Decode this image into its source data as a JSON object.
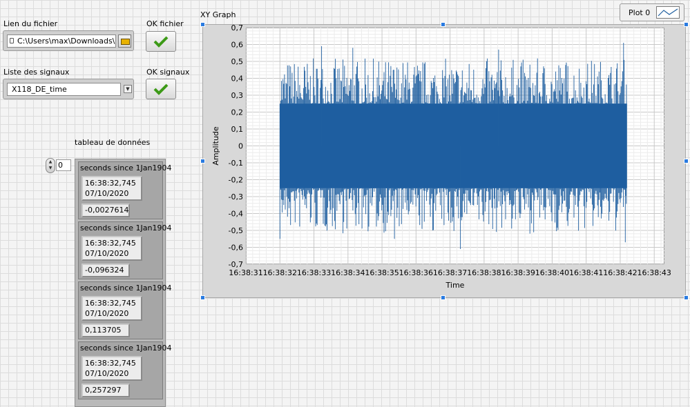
{
  "file_section": {
    "label": "Lien du fichier",
    "path_value": "C:\\Users\\max\\Downloads\\",
    "ok_label": "OK fichier"
  },
  "signal_section": {
    "label": "Liste des signaux",
    "selected": "X118_DE_time",
    "ok_label": "OK signaux"
  },
  "data_table": {
    "label": "tableau de données",
    "index": "0",
    "clusters": [
      {
        "title": "seconds since 1Jan1904",
        "time": "16:38:32,745",
        "date": "07/10/2020",
        "value": "-0,0027614"
      },
      {
        "title": "seconds since 1Jan1904",
        "time": "16:38:32,745",
        "date": "07/10/2020",
        "value": "-0,096324"
      },
      {
        "title": "seconds since 1Jan1904",
        "time": "16:38:32,745",
        "date": "07/10/2020",
        "value": "0,113705"
      },
      {
        "title": "seconds since 1Jan1904",
        "time": "16:38:32,745",
        "date": "07/10/2020",
        "value": "0,257297"
      }
    ]
  },
  "graph": {
    "title": "XY Graph",
    "legend_label": "Plot 0",
    "plot_color": "#1f5fa0"
  },
  "chart_data": {
    "type": "line",
    "title": "XY Graph",
    "xlabel": "Time",
    "ylabel": "Amplitude",
    "x_ticks": [
      "16:38:31",
      "16:38:32",
      "16:38:33",
      "16:38:34",
      "16:38:35",
      "16:38:36",
      "16:38:37",
      "16:38:38",
      "16:38:39",
      "16:38:40",
      "16:38:41",
      "16:38:42",
      "16:38:43"
    ],
    "y_ticks": [
      "0,7",
      "0,6",
      "0,5",
      "0,4",
      "0,3",
      "0,2",
      "0,1",
      "0",
      "-0,1",
      "-0,2",
      "-0,3",
      "-0,4",
      "-0,5",
      "-0,6",
      "-0,7"
    ],
    "xlim": [
      "16:38:31",
      "16:38:43"
    ],
    "ylim": [
      -0.7,
      0.7
    ],
    "grid": true,
    "series": [
      {
        "name": "Plot 0",
        "x_start": "16:38:32",
        "x_end": "16:38:42,2",
        "dense_range": [
          -0.25,
          0.25
        ],
        "peak_min": -0.61,
        "peak_max": 0.61
      }
    ]
  }
}
